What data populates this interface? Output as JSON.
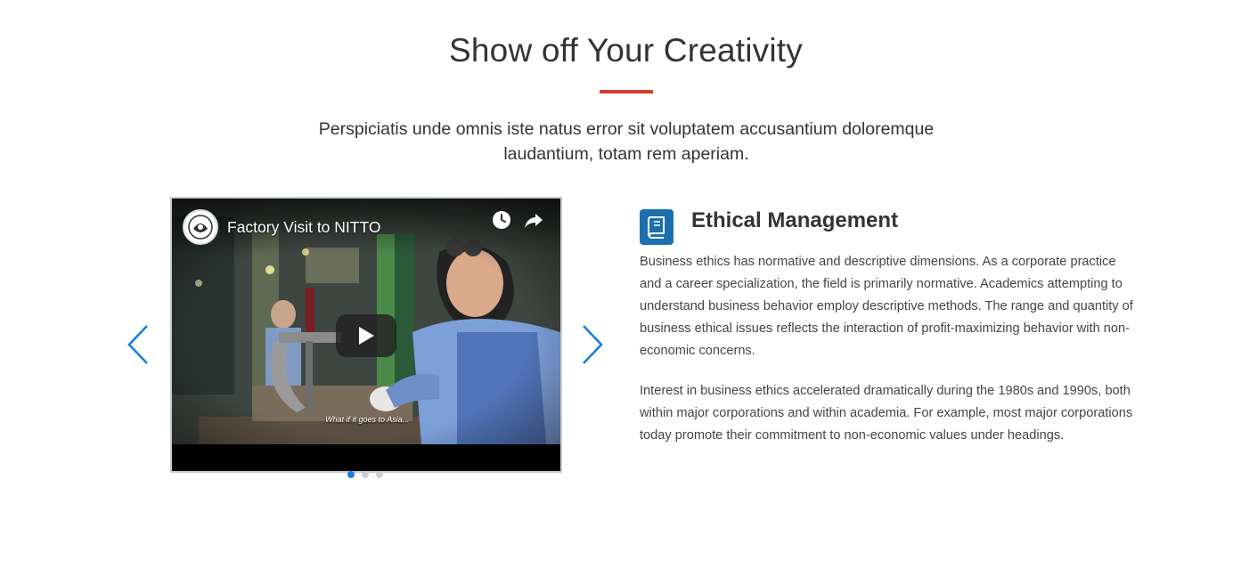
{
  "section": {
    "title": "Show off Your Creativity",
    "lead": "Perspiciatis unde omnis iste natus error sit voluptatem accusantium doloremque laudantium, totam rem aperiam.",
    "accent_color": "#d9392b"
  },
  "carousel": {
    "prev_icon": "chevron-left-icon",
    "next_icon": "chevron-right-icon",
    "arrow_color": "#1a7fe0",
    "dots": [
      {
        "active": true
      },
      {
        "active": false
      },
      {
        "active": false
      }
    ],
    "video": {
      "title": "Factory Visit to NITTO",
      "subtitle": "What if it goes to Asia...",
      "channel_icon": "channel-logo-icon",
      "watch_later_icon": "clock-icon",
      "share_icon": "share-arrow-icon",
      "play_icon": "play-icon"
    }
  },
  "feature": {
    "icon": "book-icon",
    "icon_bg": "#1c6fae",
    "title": "Ethical Management",
    "paragraphs": [
      "Business ethics has normative and descriptive dimensions. As a corporate practice and a career specialization, the field is primarily normative. Academics attempting to understand business behavior employ descriptive methods. The range and quantity of business ethical issues reflects the interaction of profit-maximizing behavior with non-economic concerns.",
      "Interest in business ethics accelerated dramatically during the 1980s and 1990s, both within major corporations and within academia. For example, most major corporations today promote their commitment to non-economic values under headings."
    ]
  }
}
